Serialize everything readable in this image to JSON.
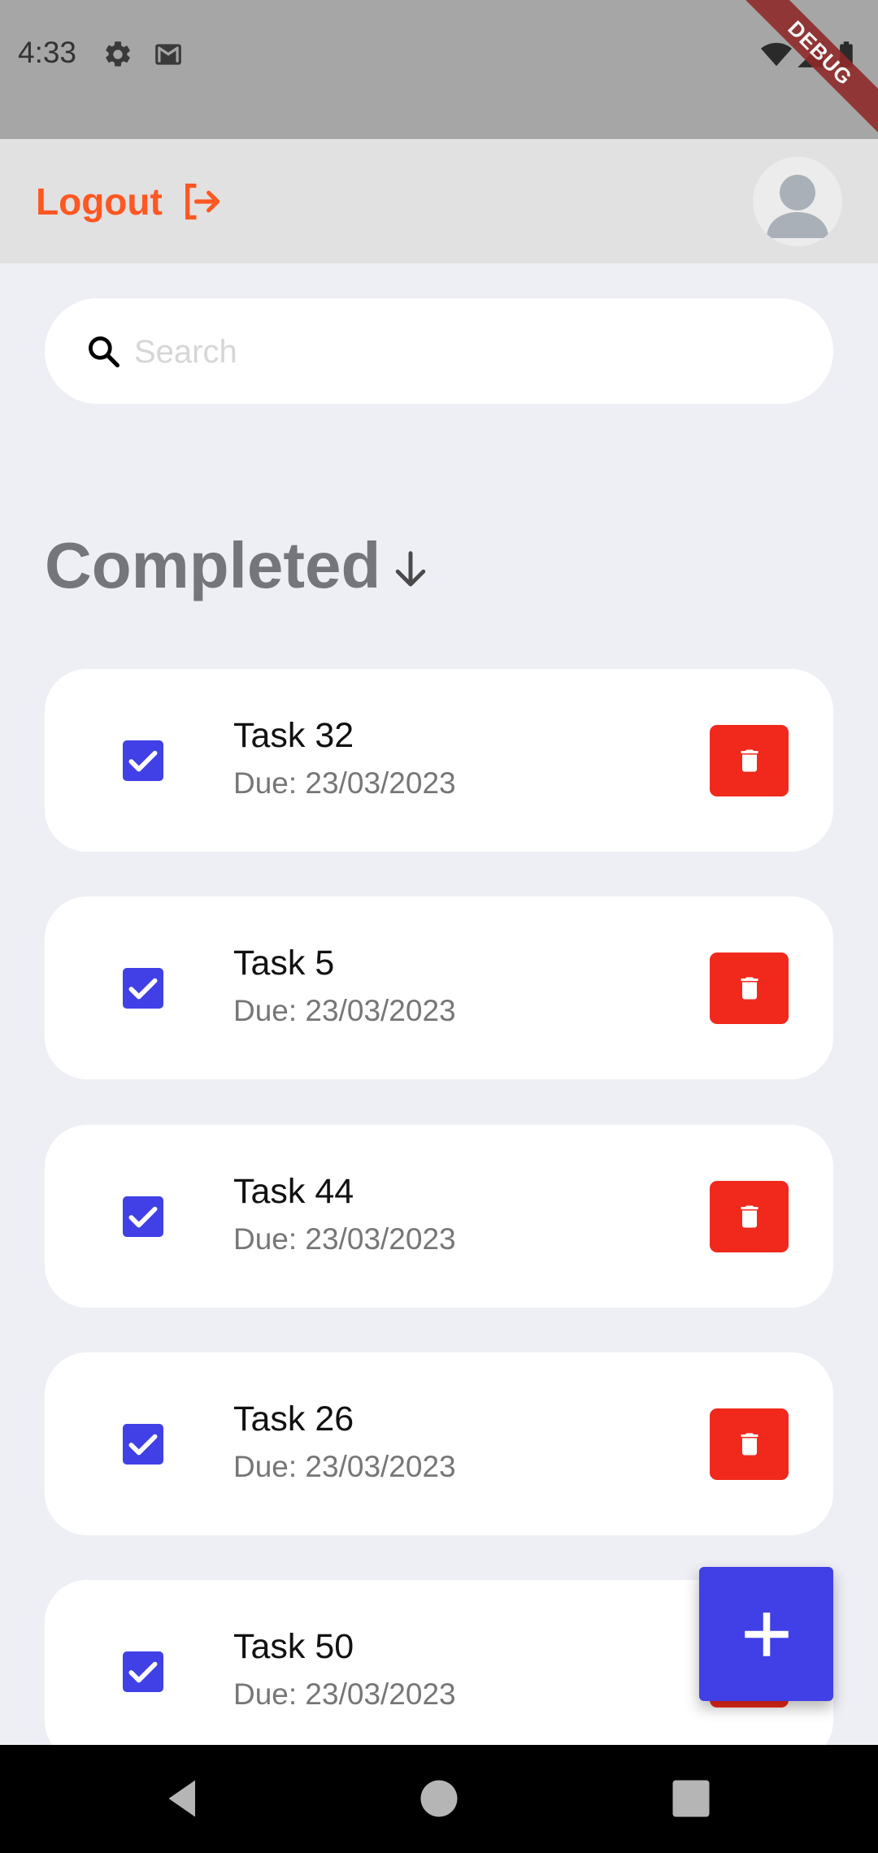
{
  "status_bar": {
    "time": "4:33",
    "debug_label": "DEBUG"
  },
  "app_bar": {
    "logout_label": "Logout"
  },
  "search": {
    "placeholder": "Search",
    "value": ""
  },
  "section": {
    "title": "Completed"
  },
  "tasks": [
    {
      "title": "Task 32",
      "due": "Due: 23/03/2023",
      "completed": true
    },
    {
      "title": "Task 5",
      "due": "Due: 23/03/2023",
      "completed": true
    },
    {
      "title": "Task 44",
      "due": "Due: 23/03/2023",
      "completed": true
    },
    {
      "title": "Task 26",
      "due": "Due: 23/03/2023",
      "completed": true
    },
    {
      "title": "Task 50",
      "due": "Due: 23/03/2023",
      "completed": true
    }
  ],
  "icons": {
    "status": [
      "settings-icon",
      "gmail-icon",
      "wifi-icon",
      "signal-icon",
      "battery-icon"
    ],
    "logout": "logout-icon",
    "avatar": "person-icon",
    "search": "search-icon",
    "sort": "arrow-down-icon",
    "checkbox": "check-icon",
    "delete": "trash-icon",
    "fab": "plus-icon",
    "nav": [
      "back-icon",
      "home-icon",
      "recents-icon"
    ]
  },
  "colors": {
    "accent": "#FF5722",
    "primary": "#4040E6",
    "danger": "#F0291C",
    "background": "#EEEFF5"
  }
}
